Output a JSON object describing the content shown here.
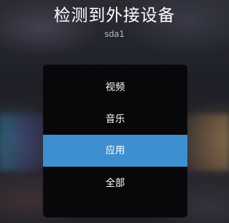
{
  "dialog": {
    "title": "检测到外接设备",
    "device_name": "sda1",
    "options": [
      {
        "label": "视频",
        "selected": false
      },
      {
        "label": "音乐",
        "selected": false
      },
      {
        "label": "应用",
        "selected": true
      },
      {
        "label": "全部",
        "selected": false
      }
    ]
  },
  "colors": {
    "selected_highlight": "#3d8fcf",
    "menu_background": "#060608",
    "text": "#ffffff",
    "subtitle_text": "#b9bcc4"
  }
}
